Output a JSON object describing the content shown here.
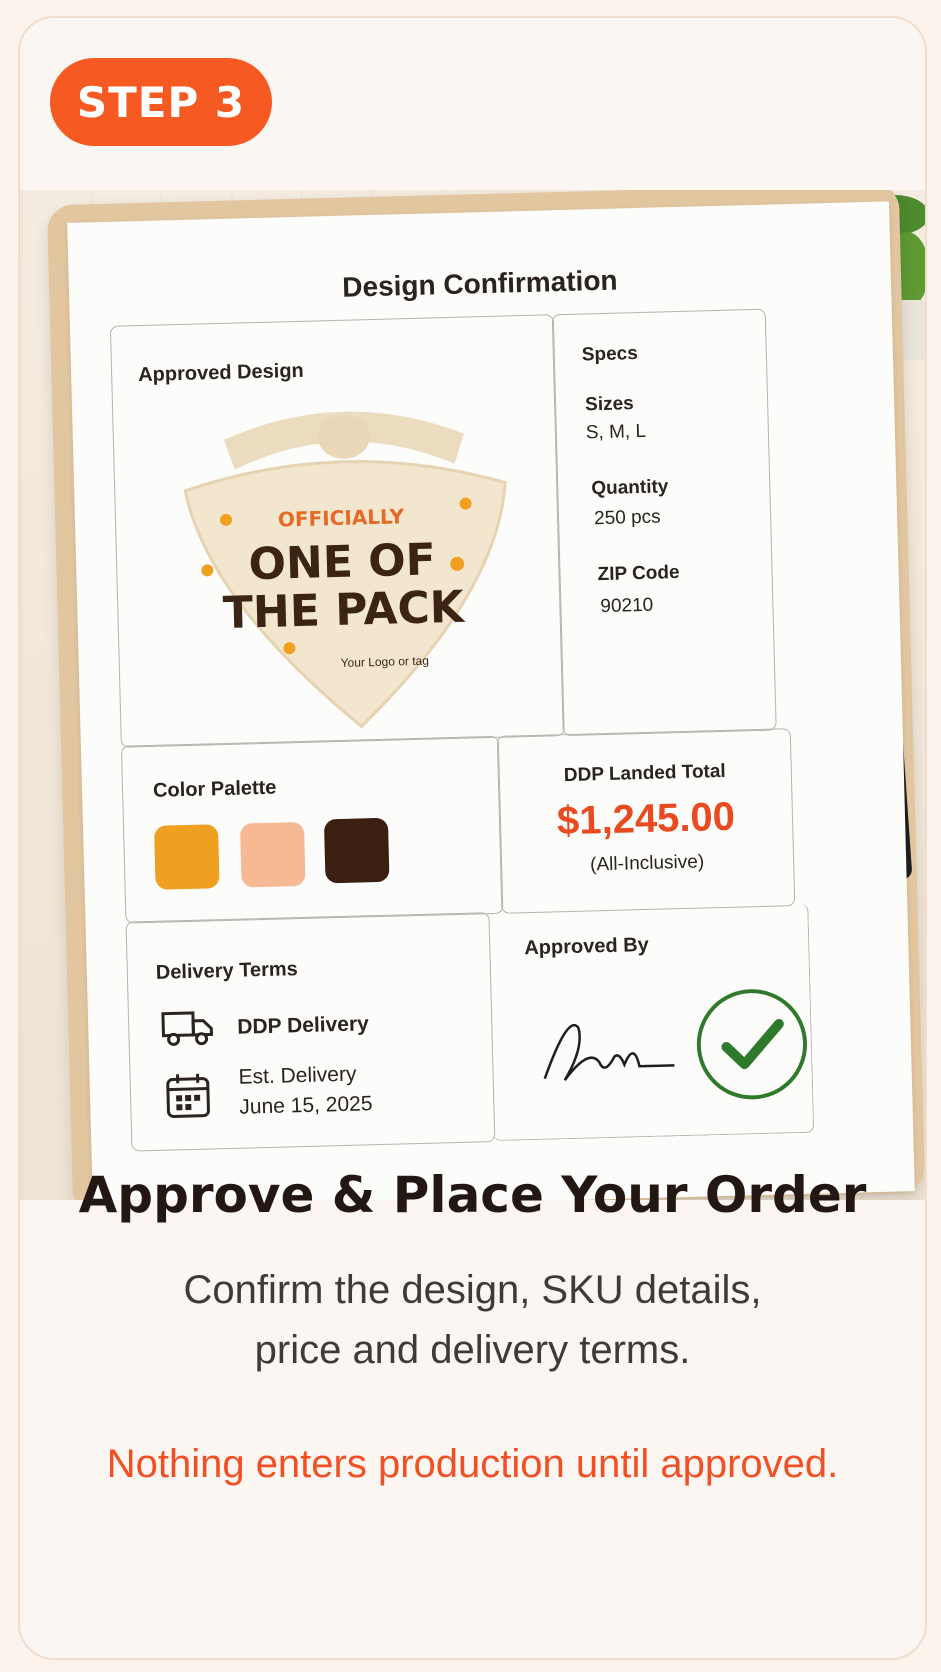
{
  "step": {
    "label": "STEP 3"
  },
  "document": {
    "title": "Design Confirmation",
    "approved_design": {
      "label": "Approved Design",
      "bandana_text": {
        "top": "OFFICIALLY",
        "line1": "ONE OF",
        "line2": "THE PACK",
        "logo": "Your Logo\nor tag"
      }
    },
    "specs": {
      "label": "Specs",
      "sizes_label": "Sizes",
      "sizes_value": "S, M, L",
      "quantity_label": "Quantity",
      "quantity_value": "250 pcs",
      "zip_label": "ZIP Code",
      "zip_value": "90210"
    },
    "color_palette": {
      "label": "Color Palette",
      "colors": [
        "#f0a020",
        "#f7b994",
        "#3a1f12"
      ]
    },
    "total": {
      "label": "DDP Landed Total",
      "amount": "$1,245.00",
      "note": "(All-Inclusive)"
    },
    "delivery": {
      "label": "Delivery Terms",
      "method": "DDP Delivery",
      "est_label": "Est. Delivery",
      "est_date": "June 15, 2025"
    },
    "approval": {
      "label": "Approved By"
    }
  },
  "headline": "Approve & Place Your Order",
  "subtext_line1": "Confirm the design, SKU details,",
  "subtext_line2": "price and delivery terms.",
  "note": "Nothing enters production until approved."
}
